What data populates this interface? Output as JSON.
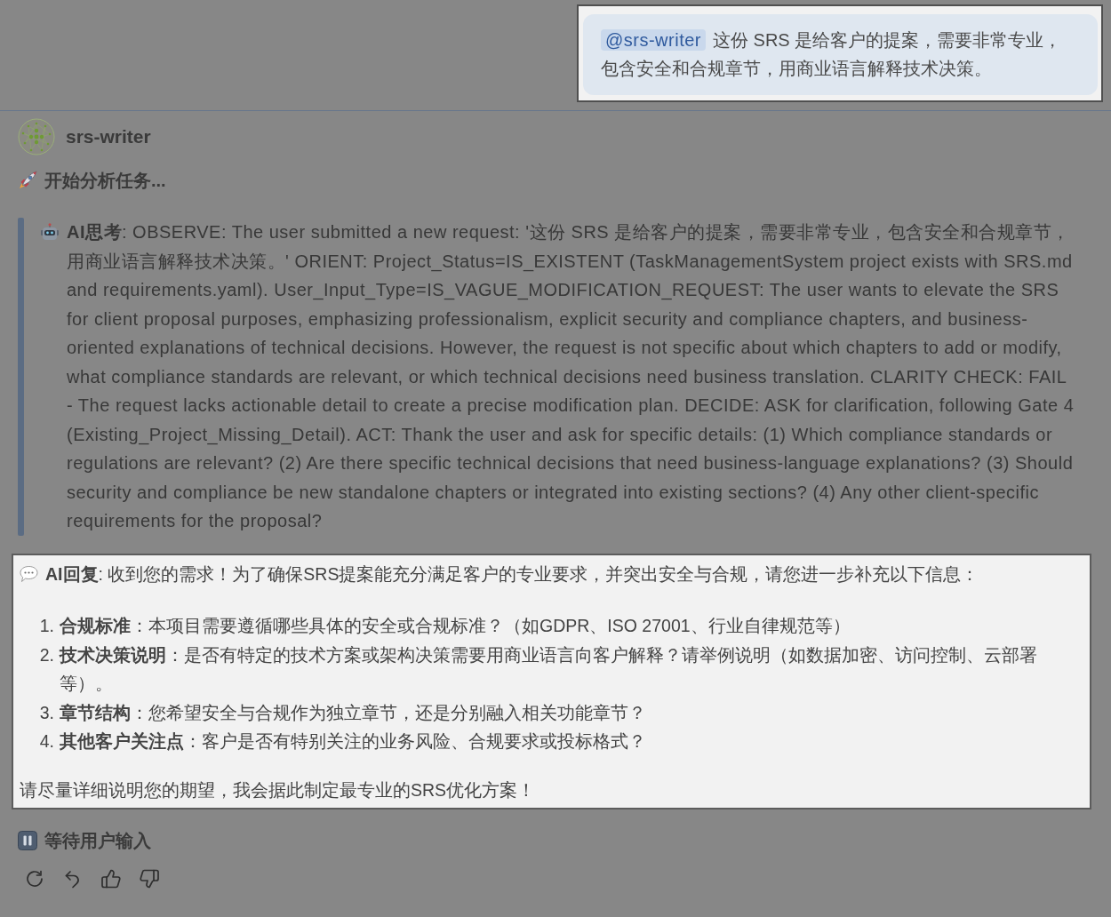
{
  "user_message": {
    "highlighted": true,
    "mention": "@srs-writer",
    "text": "这份 SRS 是给客户的提案，需要非常专业，包含安全和合规章节，用商业语言解释技术决策。"
  },
  "agent": {
    "name": "srs-writer"
  },
  "status": {
    "text": "开始分析任务..."
  },
  "thought": {
    "text": "**AI思考**: OBSERVE: The user submitted a new request: '这份 SRS 是给客户的提案，需要非常专业，包含安全和合规章节，用商业语言解释技术决策。' ORIENT: Project_Status=IS_EXISTENT (TaskManagementSystem project exists with SRS.md and requirements.yaml). User_Input_Type=IS_VAGUE_MODIFICATION_REQUEST: The user wants to elevate the SRS for client proposal purposes, emphasizing professionalism, explicit security and compliance chapters, and business-oriented explanations of technical decisions. However, the request is not specific about which chapters to add or modify, what compliance standards are relevant, or which technical decisions need business translation. CLARITY CHECK: FAIL - The request lacks actionable detail to create a precise modification plan. DECIDE: ASK for clarification, following Gate 4 (Existing_Project_Missing_Detail). ACT: Thank the user and ask for specific details: (1) Which compliance standards or regulations are relevant? (2) Are there specific technical decisions that need business-language explanations? (3) Should security and compliance be new standalone chapters or integrated into existing sections? (4) Any other client-specific requirements for the proposal?"
  },
  "reply": {
    "highlighted": true,
    "intro": "**AI回复**: 收到您的需求！为了确保SRS提案能充分满足客户的专业要求，并突出安全与合规，请您进一步补充以下信息：",
    "items": [
      {
        "number": "1.",
        "text": "**合规标准**：本项目需要遵循哪些具体的安全或合规标准？（如GDPR、ISO 27001、行业自律规范等）"
      },
      {
        "number": "2.",
        "text": "**技术决策说明**：是否有特定的技术方案或架构决策需要用商业语言向客户解释？请举例说明（如数据加密、访问控制、云部署等）。"
      },
      {
        "number": "3.",
        "text": "**章节结构**：您希望安全与合规作为独立章节，还是分别融入相关功能章节？"
      },
      {
        "number": "4.",
        "text": "**其他客户关注点**：客户是否有特别关注的业务风险、合规要求或投标格式？"
      }
    ],
    "closing": "请尽量详细说明您的期望，我会据此制定最专业的SRS优化方案！"
  },
  "waiting": {
    "text": "等待用户输入"
  },
  "actions": [
    {
      "kind": "retry"
    },
    {
      "kind": "undo"
    },
    {
      "kind": "like"
    },
    {
      "kind": "dislike"
    }
  ]
}
